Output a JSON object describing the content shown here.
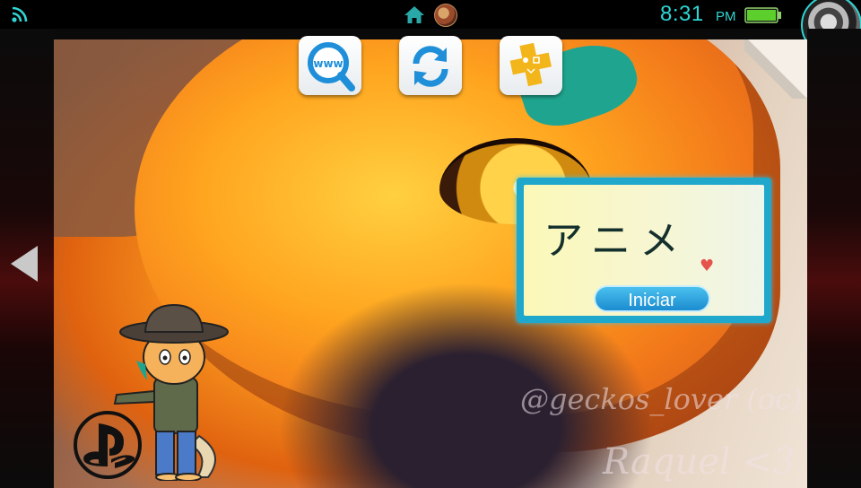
{
  "status_bar": {
    "time": "8:31",
    "meridiem": "PM",
    "accent_color": "#2fd5d5",
    "battery_level": 1.0,
    "icons": [
      "wifi-icon",
      "home-icon",
      "notification-avatar",
      "battery-icon",
      "profile-avatar"
    ]
  },
  "app_shortcuts": [
    {
      "name": "browser",
      "icon": "www-magnifier-icon"
    },
    {
      "name": "system-update",
      "icon": "refresh-arrows-icon"
    },
    {
      "name": "playstation-plus",
      "icon": "ps-plus-icon"
    }
  ],
  "live_area": {
    "title": "アニメ",
    "start_label": "Iniciar",
    "button_color": "#1b8cd0"
  },
  "wallpaper": {
    "watermark_line1": "@geckos_lover (oc)",
    "watermark_line2": "Raquel <3"
  },
  "navigation": {
    "prev_page_icon": "left-arrow-icon",
    "ps_logo": "playstation-logo"
  }
}
